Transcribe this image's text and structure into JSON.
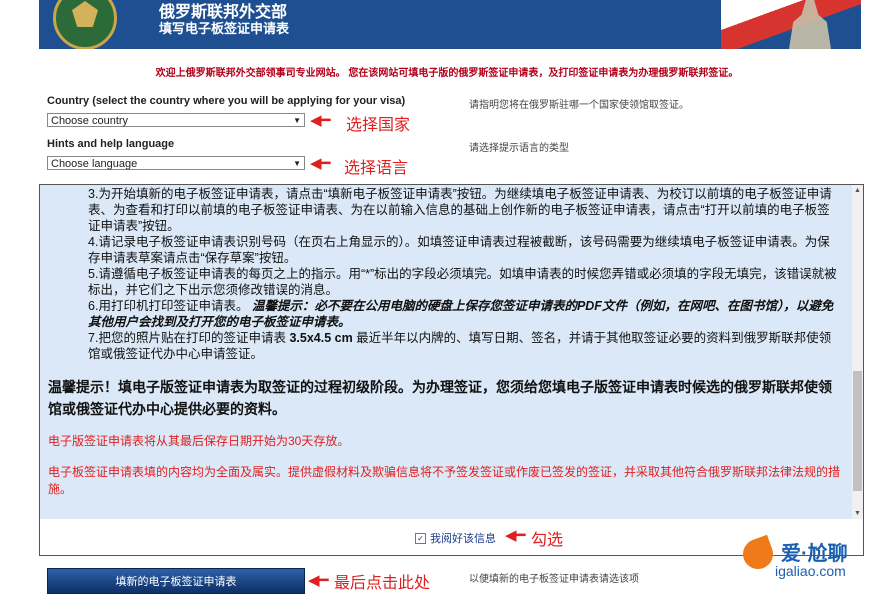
{
  "header": {
    "title": "俄罗斯联邦外交部",
    "subtitle": "填写电子板签证申请表"
  },
  "welcome": "欢迎上俄罗斯联邦外交部领事司专业网站。 您在该网站可填电子版的俄罗斯签证申请表，及打印签证申请表为办理俄罗斯联邦签证。",
  "country": {
    "label": "Country (select the country where you will be applying for your visa)",
    "selected": "Choose country",
    "hint": "请指明您将在俄罗斯驻哪一个国家使领馆取签证。",
    "annotation": "选择国家"
  },
  "language": {
    "label": "Hints and help language",
    "selected": "Choose language",
    "hint": "请选择提示语言的类型",
    "annotation": "选择语言"
  },
  "instructions": {
    "items": [
      {
        "num": "3.",
        "text": "为开始填新的电子板签证申请表，请点击“填新电子板签证申请表”按钮。为继续填电子板签证申请表、为校订以前填的电子板签证申请表、为查看和打印以前填的电子板签证申请表、为在以前输入信息的基础上创作新的电子板签证申请表，请点击“打开以前填的电子板签证申请表”按钮。"
      },
      {
        "num": "4.",
        "text": "请记录电子板签证申请表识别号码（在页右上角显示的）。如填签证申请表过程被截断，该号码需要为继续填电子板签证申请表。为保存申请表草案请点击“保存草案”按钮。"
      },
      {
        "num": "5.",
        "text": "请遵循电子板签证申请表的每页之上的指示。用“*”标出的字段必须填完。如填申请表的时候您弄错或必须填的字段无填完，该错误就被标出，并它们之下出示您须修改错误的消息。"
      },
      {
        "num": "6.",
        "text": "用打印机打印签证申请表。",
        "emphasis": "温馨提示：必不要在公用电脑的硬盘上保存您签证申请表的PDF文件（例如，在网吧、在图书馆），以避免其他用户会找到及打开您的电子板签证申请表。"
      },
      {
        "num": "7.",
        "text": "把您的照片贴在打印的签证申请表",
        "bold": "3.5x4.5 cm",
        "text2": "最近半年以内牌的、填写日期、签名，并请于其他取签证必要的资料到俄罗斯联邦使领馆或俄签证代办中心申请签证。"
      }
    ],
    "warning": "温馨提示！填电子版签证申请表为取签证的过程初级阶段。为办理签证，您须给您填电子版签证申请表时候选的俄罗斯联邦使领馆或俄签证代办中心提供必要的资料。",
    "retention": "电子版签证申请表将从其最后保存日期开始为30天存放。",
    "truth": "电子板签证申请表填的内容均为全面及属实。提供虚假材料及欺骗信息将不予签发签证或作废已签发的签证，并采取其他符合俄罗斯联邦法律法规的措施。"
  },
  "agree": {
    "label": "我阅好该信息",
    "checked": true,
    "annotation": "勾选"
  },
  "submit": {
    "label": "填新的电子板签证申请表",
    "hint": "以便填新的电子板签证申请表请选该项",
    "annotation": "最后点击此处"
  },
  "watermark": {
    "brand": "爱·尬聊",
    "url": "igaliao.com"
  },
  "colors": {
    "header_bg": "#1d4f91",
    "annotation": "#e02020",
    "panel_bg": "#dae8f7"
  }
}
